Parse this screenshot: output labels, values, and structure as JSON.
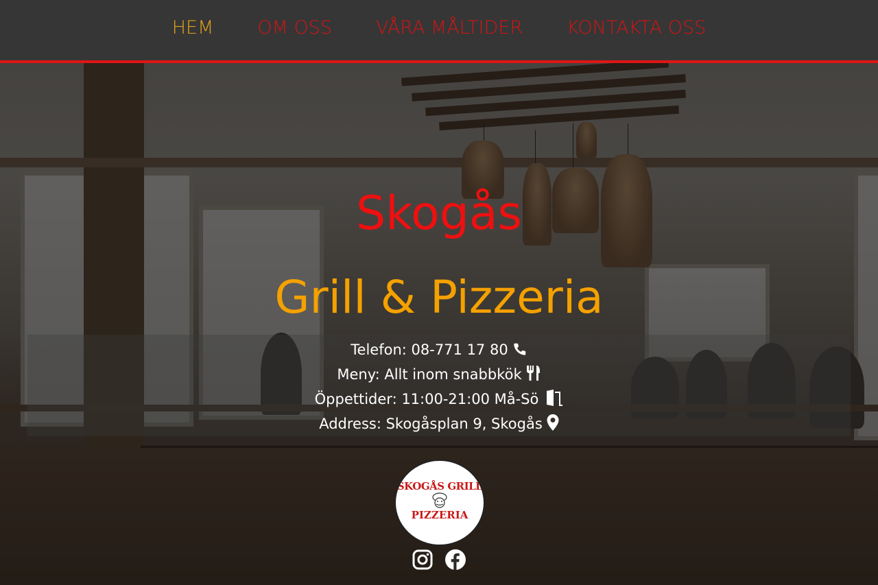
{
  "nav": {
    "items": [
      {
        "label": "HEM"
      },
      {
        "label": "OM OSS"
      },
      {
        "label": "VÅRA MÅLTIDER"
      },
      {
        "label": "KONTAKTA OSS"
      }
    ],
    "colors": {
      "active": "#e3a21a",
      "default": "#d41414",
      "underline": "#e01515"
    }
  },
  "hero": {
    "title_line1": "Skogås",
    "title_line2": "Grill & Pizzeria",
    "colors": {
      "line1": "#ee1010",
      "line2": "#f4a100"
    }
  },
  "info": {
    "phone": {
      "text": "Telefon:  08-771 17 80",
      "icon": "phone-icon"
    },
    "menu": {
      "text": "Meny:  Allt inom snabbkök",
      "icon": "utensils-icon"
    },
    "hours": {
      "text": "Öppettider:  11:00-21:00 Må-Sö",
      "icon": "door-open-icon"
    },
    "address": {
      "text": "Address:  Skogåsplan 9, Skogås",
      "icon": "map-pin-icon"
    }
  },
  "logo": {
    "line1": "SKOGÅS GRILL",
    "line2": "PIZZERIA"
  },
  "social": {
    "icons": [
      "instagram-icon",
      "facebook-icon"
    ]
  }
}
